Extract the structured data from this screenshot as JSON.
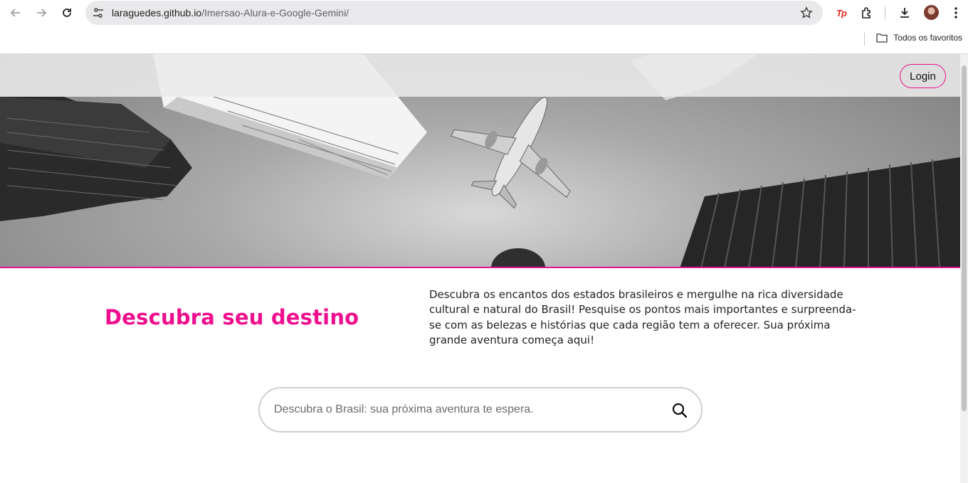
{
  "browser": {
    "url_host": "laraguedes.github.io",
    "url_path": "/Imersao-Alura-e-Google-Gemini/",
    "bookmarks_label": "Todos os favoritos",
    "extension_label": "Tp"
  },
  "header": {
    "login_label": "Login"
  },
  "main": {
    "headline": "Descubra seu destino",
    "description": "Descubra os encantos dos estados brasileiros e mergulhe na rica diversidade cultural e natural do Brasil! Pesquise os pontos mais importantes e surpreenda-se com as belezas e histórias que cada região tem a oferecer. Sua próxima grande aventura começa aqui!"
  },
  "search": {
    "placeholder": "Descubra o Brasil: sua próxima aventura te espera."
  },
  "colors": {
    "accent": "#ee0e8e",
    "hero_border": "#e6108c"
  },
  "icons": [
    "back-icon",
    "forward-icon",
    "reload-icon",
    "site-info-icon",
    "star-icon",
    "extensions-icon",
    "download-icon",
    "kebab-menu-icon",
    "folder-icon",
    "search-icon"
  ]
}
